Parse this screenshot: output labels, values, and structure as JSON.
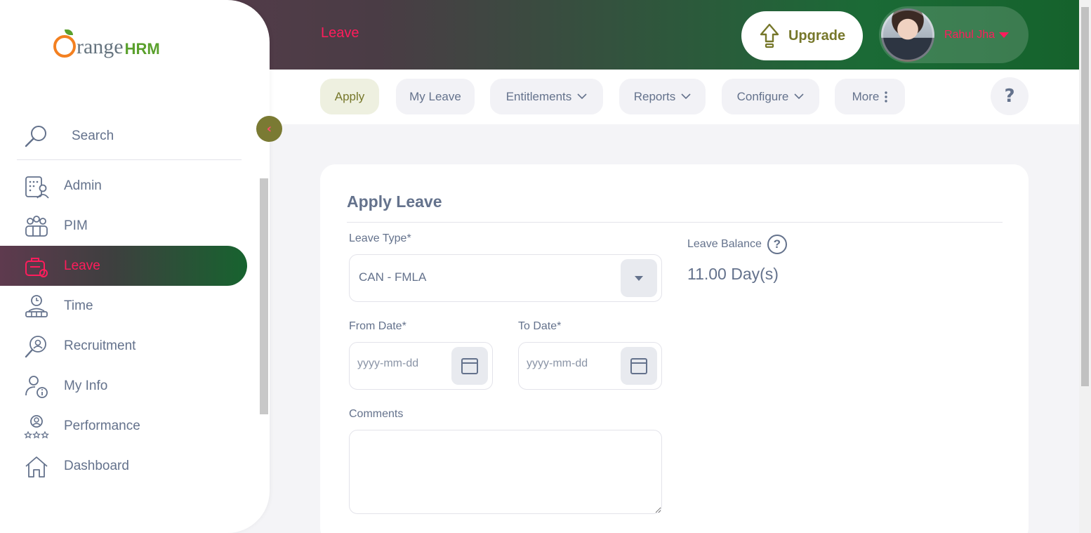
{
  "header": {
    "module_title": "Leave",
    "upgrade_label": "Upgrade",
    "user_name": "Rahul Jha"
  },
  "logo": {
    "text_main": "range",
    "text_hrm": "HRM"
  },
  "sidebar": {
    "search_label": "Search",
    "items": [
      {
        "label": "Admin",
        "icon": "admin-icon",
        "active": false
      },
      {
        "label": "PIM",
        "icon": "pim-icon",
        "active": false
      },
      {
        "label": "Leave",
        "icon": "leave-icon",
        "active": true
      },
      {
        "label": "Time",
        "icon": "time-icon",
        "active": false
      },
      {
        "label": "Recruitment",
        "icon": "recruitment-icon",
        "active": false
      },
      {
        "label": "My Info",
        "icon": "my-info-icon",
        "active": false
      },
      {
        "label": "Performance",
        "icon": "performance-icon",
        "active": false
      },
      {
        "label": "Dashboard",
        "icon": "dashboard-icon",
        "active": false
      }
    ]
  },
  "tabs": {
    "apply": "Apply",
    "my_leave": "My Leave",
    "entitlements": "Entitlements",
    "reports": "Reports",
    "configure": "Configure",
    "more": "More",
    "help": "?"
  },
  "form": {
    "title": "Apply Leave",
    "leave_type_label": "Leave Type*",
    "leave_type_value": "CAN - FMLA",
    "leave_balance_label": "Leave Balance",
    "leave_balance_value": "11.00 Day(s)",
    "from_date_label": "From Date*",
    "from_date_placeholder": "yyyy-mm-dd",
    "to_date_label": "To Date*",
    "to_date_placeholder": "yyyy-mm-dd",
    "comments_label": "Comments"
  },
  "colors": {
    "accent_pink": "#ff1c5c",
    "brand_olive": "#76772a",
    "text_gray": "#64728c",
    "header_gradient_start": "#5e3a4e",
    "header_gradient_end": "#15622c"
  }
}
